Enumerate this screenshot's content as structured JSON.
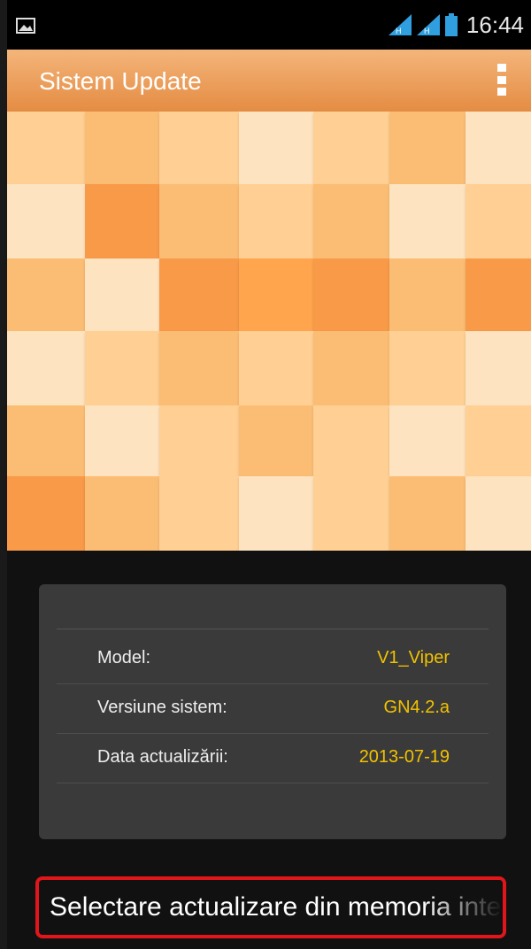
{
  "status_bar": {
    "time": "16:44",
    "icons": [
      "image-notification-icon",
      "signal-icon",
      "signal-icon",
      "battery-icon"
    ],
    "accent": "#2f9fe0"
  },
  "app_bar": {
    "title": "Sistem Update",
    "menu_icon": "overflow-menu-icon",
    "color": "#e8975a"
  },
  "info": {
    "rows": [
      {
        "label": "Model:",
        "value": "V1_Viper"
      },
      {
        "label": "Versiune sistem:",
        "value": "GN4.2.a"
      },
      {
        "label": "Data actualizării:",
        "value": "2013-07-19"
      }
    ],
    "value_color": "#f2c200"
  },
  "select_button": {
    "label": "Selectare actualizare din memoria internă"
  },
  "mosaic_palette": [
    "#fbbd74",
    "#ffa54d",
    "#fde3bf",
    "#ffcf93",
    "#f89a48"
  ]
}
